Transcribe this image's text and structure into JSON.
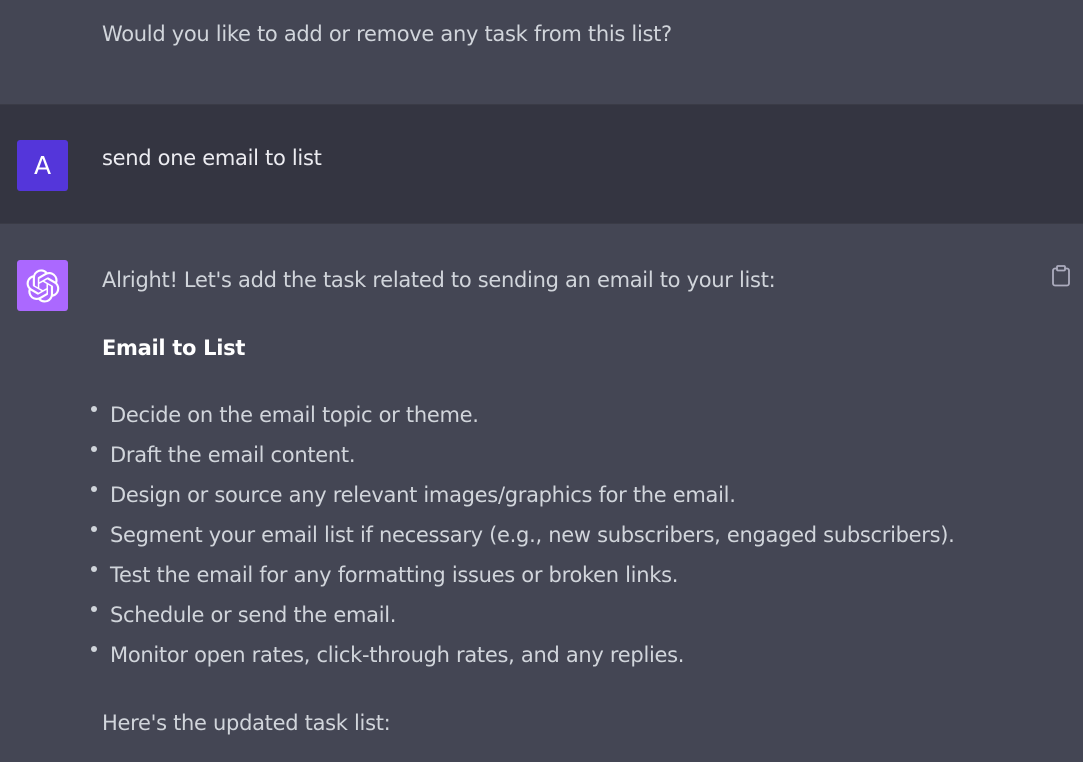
{
  "previous_message": {
    "text": "Would you like to add or remove any task from this list?"
  },
  "user_message": {
    "avatar_letter": "A",
    "text": "send one email to list",
    "avatar_color": "#5436da"
  },
  "assistant_message": {
    "avatar_icon": "openai-logo-icon",
    "avatar_color": "#ab68ff",
    "intro": "Alright! Let's add the task related to sending an email to your list:",
    "heading": "Email to List",
    "bullets": [
      "Decide on the email topic or theme.",
      "Draft the email content.",
      "Design or source any relevant images/graphics for the email.",
      "Segment your email list if necessary (e.g., new subscribers, engaged subscribers).",
      "Test the email for any formatting issues or broken links.",
      "Schedule or send the email.",
      "Monitor open rates, click-through rates, and any replies."
    ],
    "outro": "Here's the updated task list:",
    "copy_icon": "clipboard-icon"
  },
  "colors": {
    "assistant_bg": "#444654",
    "user_bg": "#343541",
    "text": "#d1d5db"
  }
}
